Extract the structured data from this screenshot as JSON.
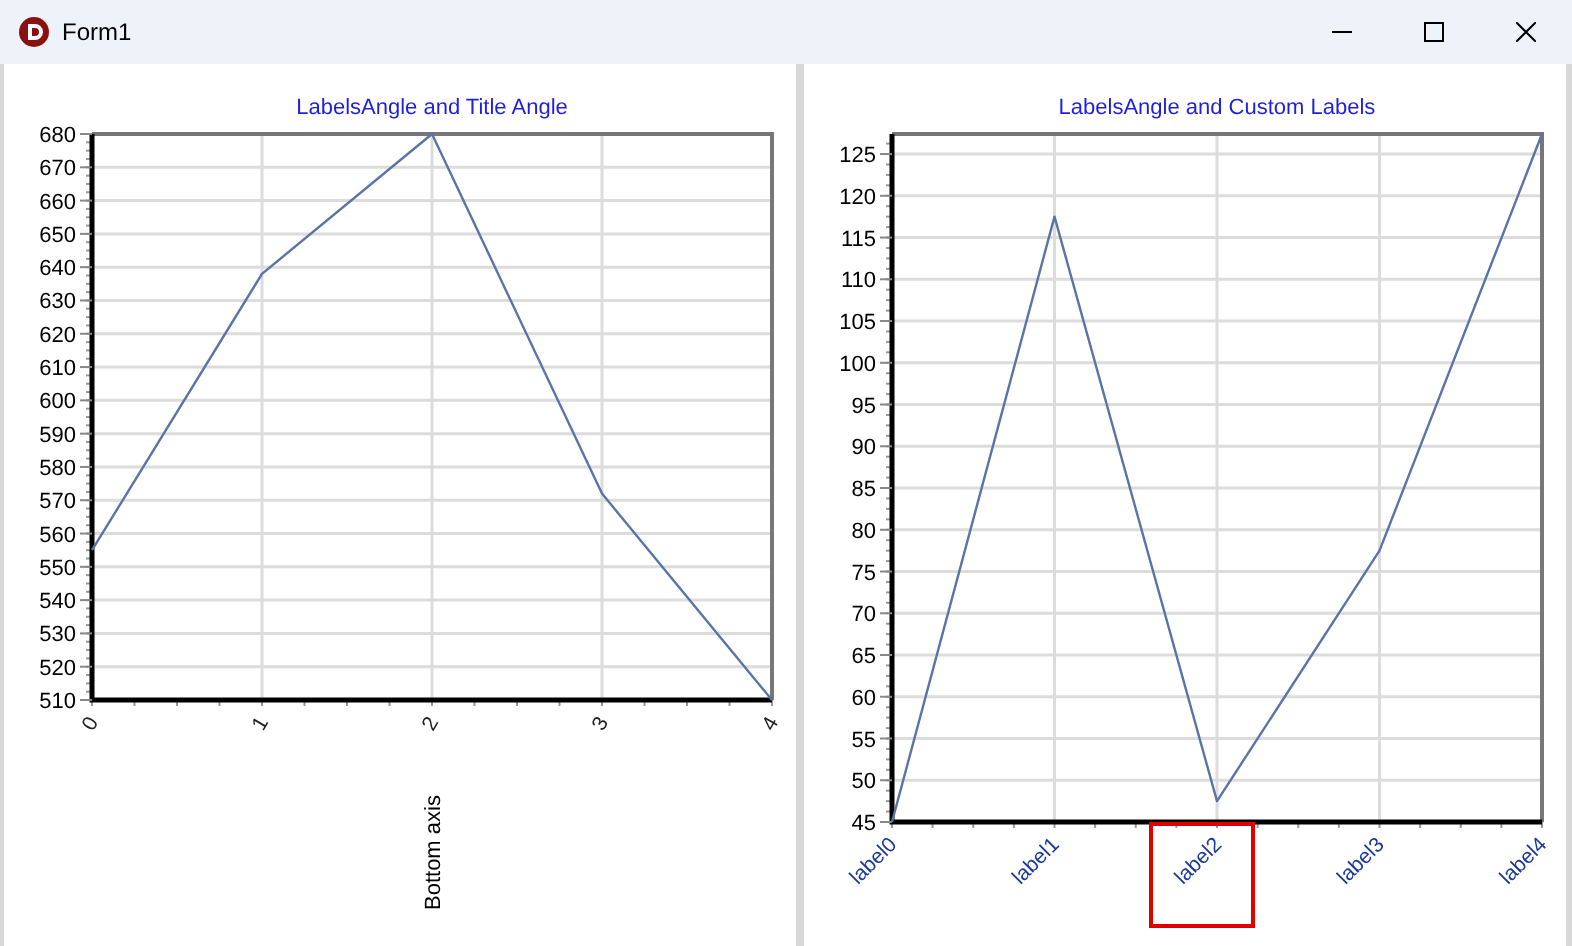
{
  "window": {
    "title": "Form1"
  },
  "charts": [
    {
      "chart_data": {
        "type": "line",
        "title": "LabelsAngle and Title Angle",
        "x": [
          0,
          1,
          2,
          3,
          4
        ],
        "grid": true,
        "series": [
          {
            "color": "#5a74a8",
            "values": [
              555,
              638,
              680,
              572,
              510
            ]
          }
        ],
        "xlim": [
          0,
          4
        ],
        "ylim": [
          510,
          680
        ],
        "xticks": [
          {
            "value": 0,
            "label": "0"
          },
          {
            "value": 1,
            "label": "1"
          },
          {
            "value": 2,
            "label": "2"
          },
          {
            "value": 3,
            "label": "3"
          },
          {
            "value": 4,
            "label": "4"
          }
        ],
        "yticks": [
          510,
          520,
          530,
          540,
          550,
          560,
          570,
          580,
          590,
          600,
          610,
          620,
          630,
          640,
          650,
          660,
          670,
          680
        ]
      },
      "rotated_axis_title": "Bottom axis"
    },
    {
      "chart_data": {
        "type": "line",
        "title": "LabelsAngle and Custom Labels",
        "categories": [
          "label0",
          "label1",
          "label2",
          "label3",
          "label4"
        ],
        "grid": true,
        "series": [
          {
            "color": "#5a74a8",
            "values": [
              45,
              117.5,
              47.5,
              77.5,
              127.4
            ]
          }
        ],
        "ylim": [
          45,
          127.4
        ],
        "yticks": [
          45,
          50,
          55,
          60,
          65,
          70,
          75,
          80,
          85,
          90,
          95,
          100,
          105,
          110,
          115,
          120,
          125
        ]
      },
      "label_highlighted": [
        false,
        false,
        true,
        false,
        false
      ]
    }
  ]
}
